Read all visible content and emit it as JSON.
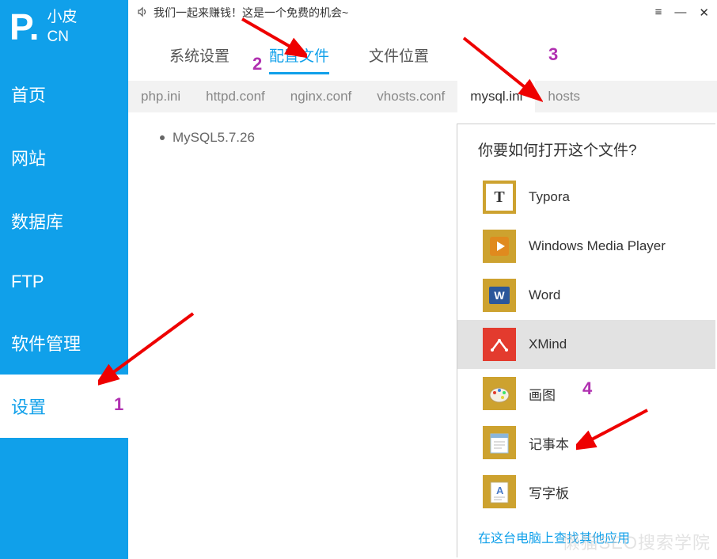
{
  "logo": {
    "brand_top": "小皮",
    "brand_bottom": "CN"
  },
  "sidebar": {
    "items": [
      {
        "label": "首页"
      },
      {
        "label": "网站"
      },
      {
        "label": "数据库"
      },
      {
        "label": "FTP"
      },
      {
        "label": "软件管理"
      },
      {
        "label": "设置"
      }
    ]
  },
  "titlebar": {
    "promo": "我们一起来赚钱！这是一个免费的机会~"
  },
  "tabs": [
    {
      "label": "系统设置"
    },
    {
      "label": "配置文件"
    },
    {
      "label": "文件位置"
    }
  ],
  "subtabs": [
    {
      "label": "php.ini"
    },
    {
      "label": "httpd.conf"
    },
    {
      "label": "nginx.conf"
    },
    {
      "label": "vhosts.conf"
    },
    {
      "label": "mysql.ini"
    },
    {
      "label": "hosts"
    }
  ],
  "content": {
    "list": [
      {
        "label": "MySQL5.7.26"
      }
    ]
  },
  "dialog": {
    "title": "你要如何打开这个文件?",
    "apps": [
      {
        "name": "Typora"
      },
      {
        "name": "Windows Media Player"
      },
      {
        "name": "Word"
      },
      {
        "name": "XMind"
      },
      {
        "name": "画图"
      },
      {
        "name": "记事本"
      },
      {
        "name": "写字板"
      }
    ],
    "footer": "在这台电脑上查找其他应用"
  },
  "annotations": {
    "n1": "1",
    "n2": "2",
    "n3": "3",
    "n4": "4"
  },
  "watermark": "懒猫SEO搜索学院"
}
